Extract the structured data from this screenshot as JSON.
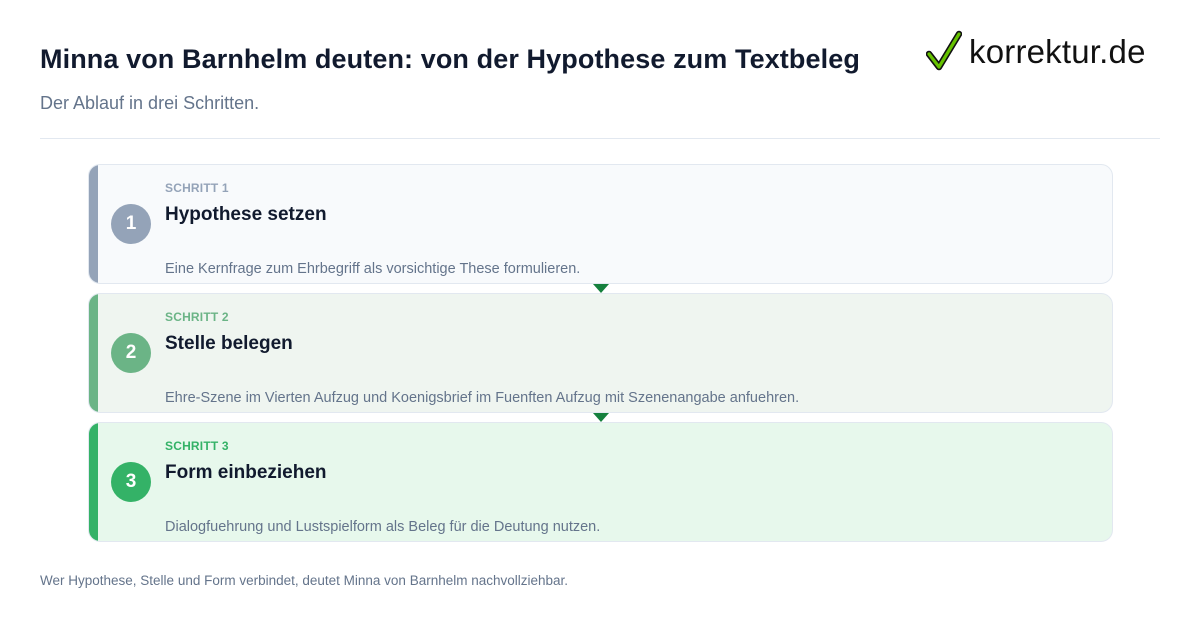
{
  "header": {
    "title": "Minna von Barnhelm deuten: von der Hypothese zum Textbeleg",
    "subtitle": "Der Ablauf in drei Schritten."
  },
  "logo": {
    "text": "korrektur.de",
    "icon": "check-icon",
    "check_color": "#66c200"
  },
  "steps": [
    {
      "number": "1",
      "label": "SCHRITT 1",
      "heading": "Hypothese setzen",
      "description": "Eine Kernfrage zum Ehrbegriff als vorsichtige These formulieren.",
      "accent": "#94a3b8",
      "background": "#f8fafc"
    },
    {
      "number": "2",
      "label": "SCHRITT 2",
      "heading": "Stelle belegen",
      "description": "Ehre-Szene im Vierten Aufzug und Koenigsbrief im Fuenften Aufzug mit Szenenangabe anfuehren.",
      "accent": "#6bb486",
      "background": "#eff5f0"
    },
    {
      "number": "3",
      "label": "SCHRITT 3",
      "heading": "Form einbeziehen",
      "description": "Dialogfuehrung und Lustspielform als Beleg für die Deutung nutzen.",
      "accent": "#34b267",
      "background": "#e7f8ec"
    }
  ],
  "connector_color": "#15803d",
  "footer": {
    "text": "Wer Hypothese, Stelle und Form verbindet, deutet Minna von Barnhelm nachvollziehbar."
  }
}
